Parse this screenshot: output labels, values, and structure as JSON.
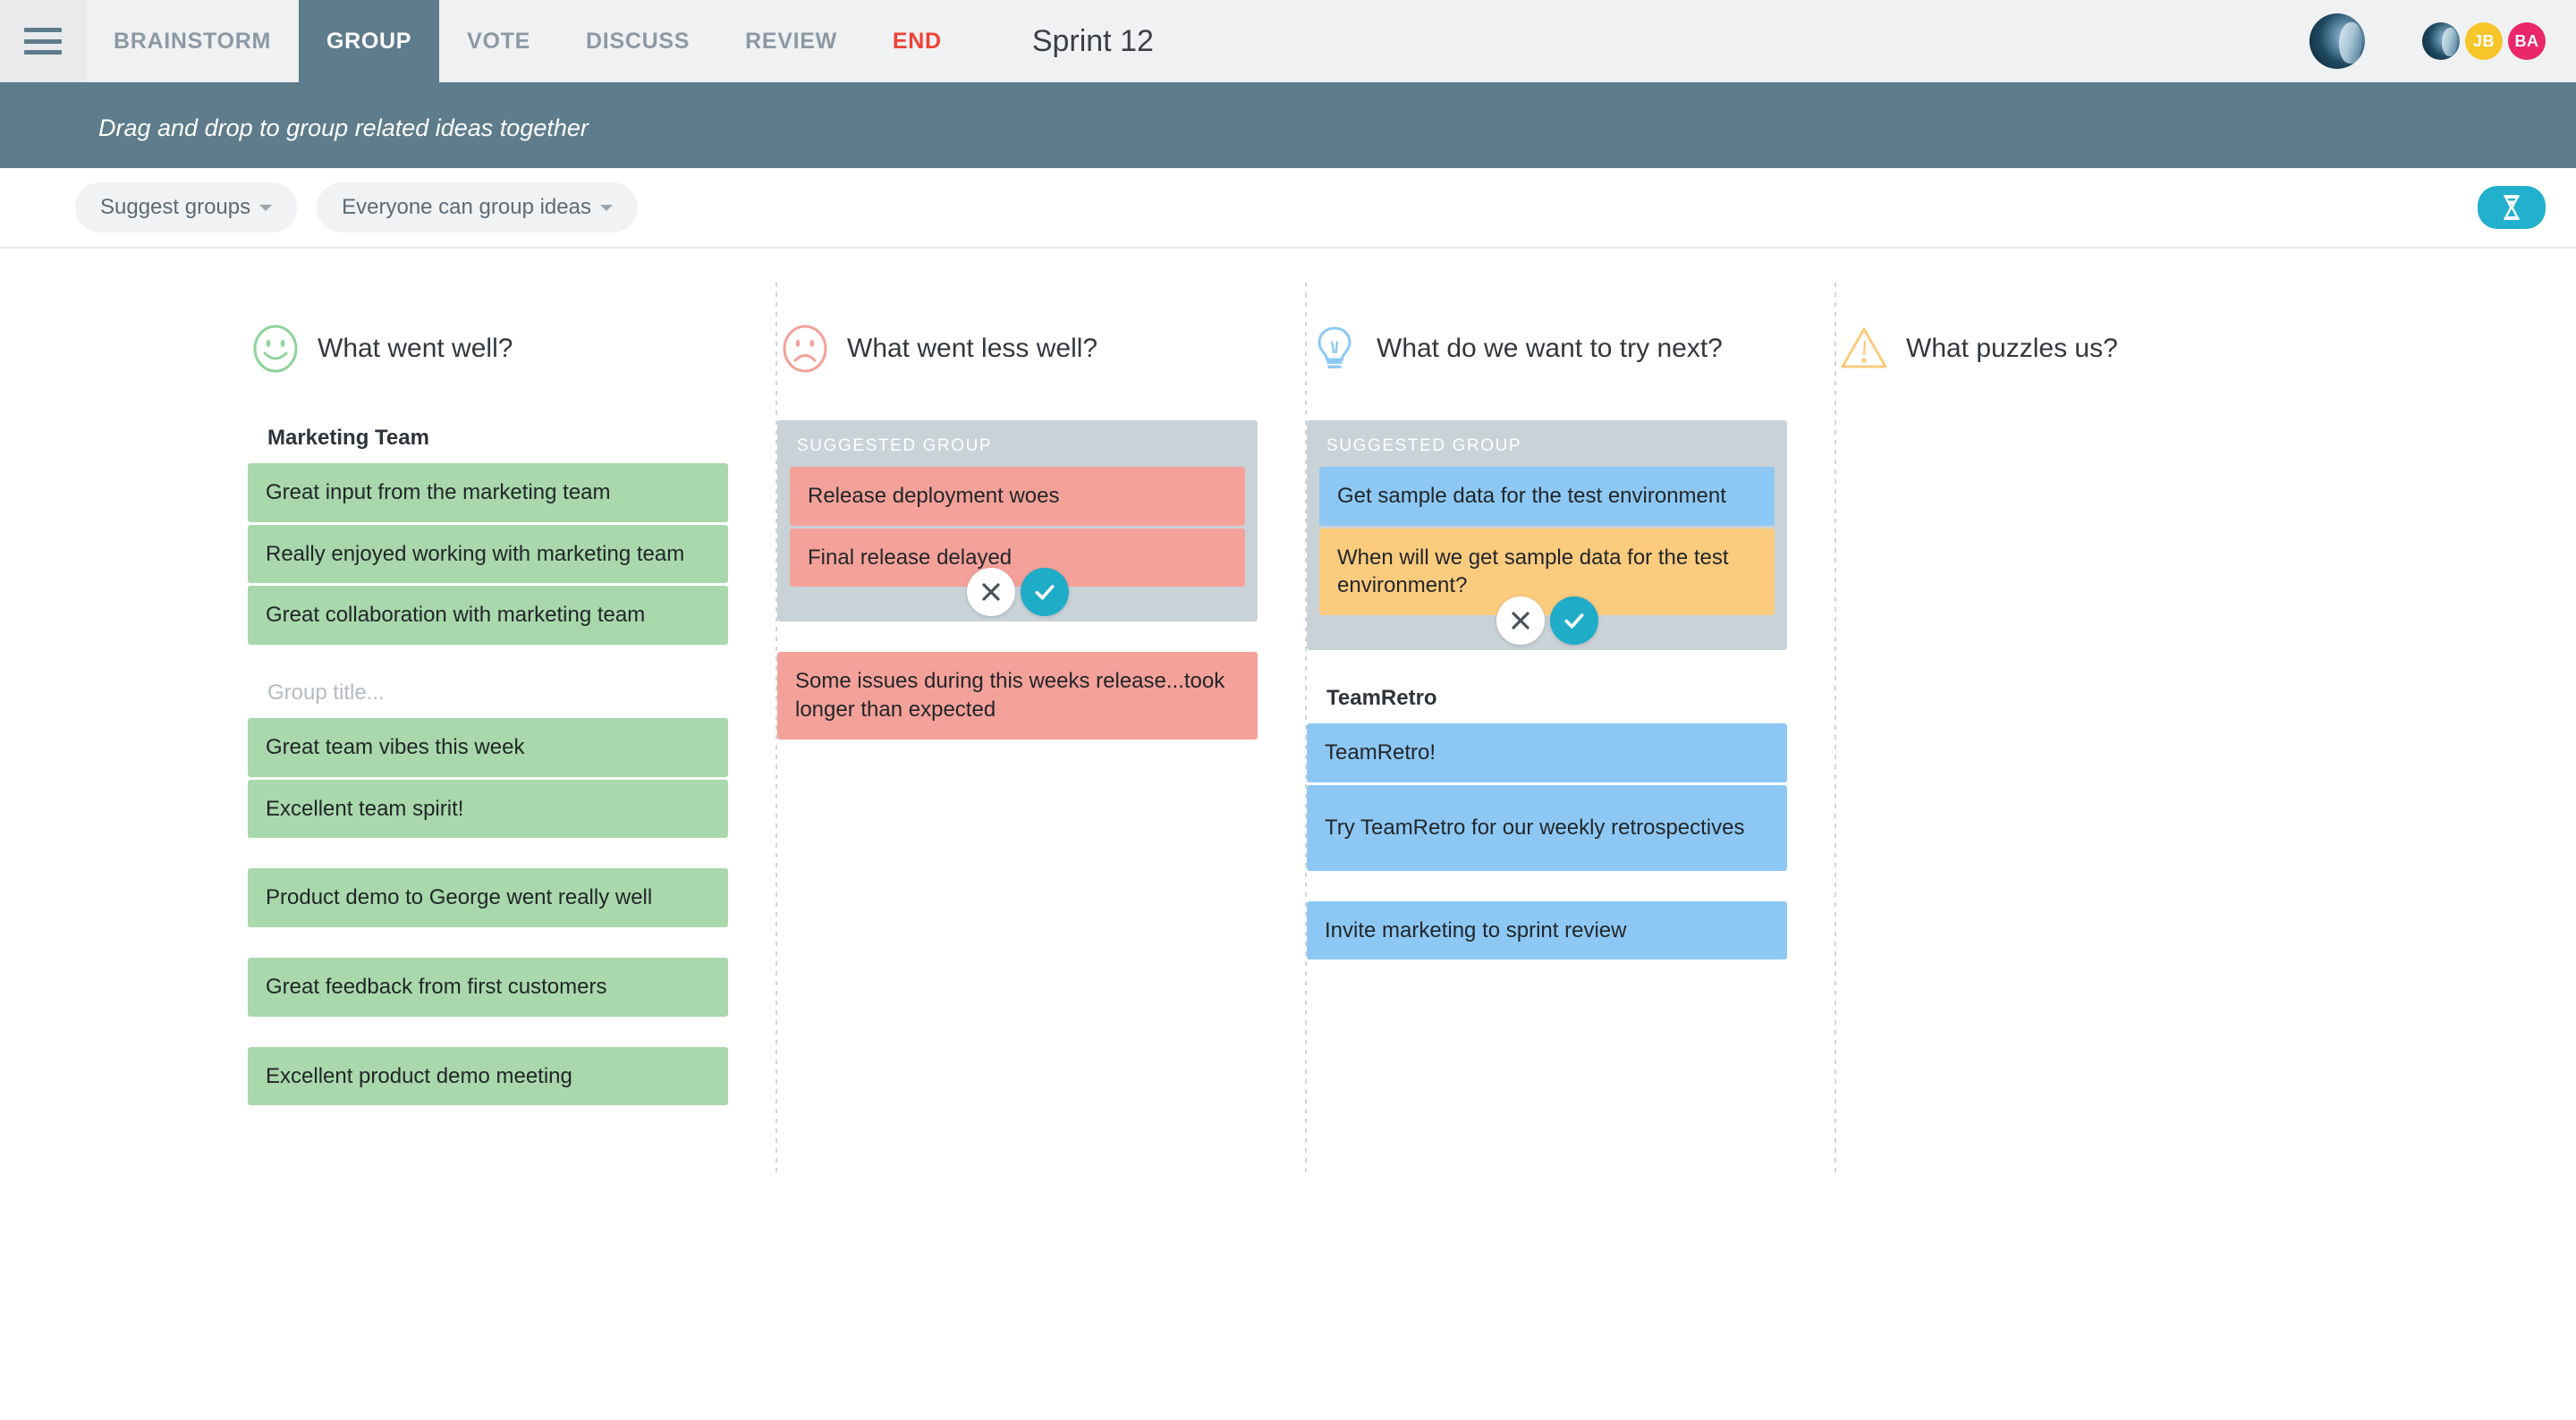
{
  "header": {
    "menu_icon": "hamburger-menu-icon",
    "tabs": [
      {
        "label": "BRAINSTORM",
        "active": false,
        "style": "normal"
      },
      {
        "label": "GROUP",
        "active": true,
        "style": "normal"
      },
      {
        "label": "VOTE",
        "active": false,
        "style": "normal"
      },
      {
        "label": "DISCUSS",
        "active": false,
        "style": "normal"
      },
      {
        "label": "REVIEW",
        "active": false,
        "style": "normal"
      },
      {
        "label": "END",
        "active": false,
        "style": "end"
      }
    ],
    "title": "Sprint 12",
    "active_tab_color": "#5e7c8b",
    "end_tab_color": "#ef4136",
    "participants": [
      {
        "type": "photo",
        "initials": ""
      },
      {
        "initials": "JB",
        "color": "#f6c52a"
      },
      {
        "initials": "BA",
        "color": "#ea276b"
      }
    ]
  },
  "instruction": {
    "text": "Drag and drop to group related ideas together",
    "background": "#5e7c8b"
  },
  "toolbar": {
    "suggest_groups_label": "Suggest groups",
    "permissions_label": "Everyone can group ideas",
    "timer_icon": "hourglass-timer-icon",
    "timer_color": "#21b0cd"
  },
  "columns": [
    {
      "icon": "happy-face-icon",
      "icon_color": "#8ed39b",
      "title": "What went well?",
      "groups": [
        {
          "suggested": false,
          "title": "Marketing Team",
          "title_is_placeholder": false,
          "cards": [
            {
              "text": "Great input from the marketing team",
              "color": "green"
            },
            {
              "text": "Really enjoyed working with marketing team",
              "color": "green"
            },
            {
              "text": "Great collaboration with marketing team",
              "color": "green"
            }
          ]
        },
        {
          "suggested": false,
          "title": "Group title...",
          "title_is_placeholder": true,
          "cards": [
            {
              "text": "Great team vibes this week",
              "color": "green"
            },
            {
              "text": "Excellent team spirit!",
              "color": "green"
            }
          ]
        },
        {
          "suggested": false,
          "title": "",
          "title_is_placeholder": false,
          "cards": [
            {
              "text": "Product demo to George went really well",
              "color": "green"
            }
          ]
        },
        {
          "suggested": false,
          "title": "",
          "title_is_placeholder": false,
          "cards": [
            {
              "text": "Great feedback from first customers",
              "color": "green"
            }
          ]
        },
        {
          "suggested": false,
          "title": "",
          "title_is_placeholder": false,
          "cards": [
            {
              "text": "Excellent product demo meeting",
              "color": "green"
            }
          ]
        }
      ]
    },
    {
      "icon": "sad-face-icon",
      "icon_color": "#f4a19a",
      "title": "What went less well?",
      "groups": [
        {
          "suggested": true,
          "title": "SUGGESTED GROUP",
          "title_is_placeholder": false,
          "reject_icon": "close-x-icon",
          "accept_icon": "check-tick-icon",
          "cards": [
            {
              "text": "Release deployment woes",
              "color": "red"
            },
            {
              "text": "Final release delayed",
              "color": "red"
            }
          ]
        },
        {
          "suggested": false,
          "title": "",
          "title_is_placeholder": false,
          "cards": [
            {
              "text": "Some issues during this weeks release...took longer than expected",
              "color": "red",
              "tall": true
            }
          ]
        }
      ]
    },
    {
      "icon": "lightbulb-icon",
      "icon_color": "#8dc8f4",
      "title": "What do we want to try next?",
      "groups": [
        {
          "suggested": true,
          "title": "SUGGESTED GROUP",
          "title_is_placeholder": false,
          "reject_icon": "close-x-icon",
          "accept_icon": "check-tick-icon",
          "cards": [
            {
              "text": "Get sample data for the test environment",
              "color": "blue"
            },
            {
              "text": "When will we get sample data for the test environment?",
              "color": "orange",
              "tall": true
            }
          ]
        },
        {
          "suggested": false,
          "title": "TeamRetro",
          "title_is_placeholder": false,
          "cards": [
            {
              "text": "TeamRetro!",
              "color": "blue"
            },
            {
              "text": "Try TeamRetro for our weekly retrospectives",
              "color": "blue",
              "tall": true
            }
          ]
        },
        {
          "suggested": false,
          "title": "",
          "title_is_placeholder": false,
          "cards": [
            {
              "text": "Invite marketing to sprint review",
              "color": "blue"
            }
          ]
        }
      ]
    },
    {
      "icon": "warning-triangle-icon",
      "icon_color": "#fbcb7e",
      "title": "What puzzles us?",
      "groups": []
    }
  ]
}
